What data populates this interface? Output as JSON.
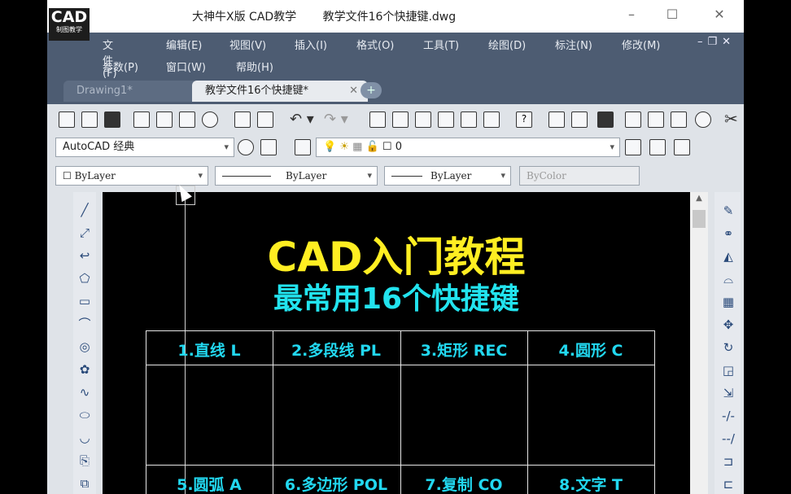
{
  "window": {
    "app_title": "大神牛X版 CAD教学",
    "file_title": "教学文件16个快捷键.dwg",
    "logo_big": "CAD",
    "logo_small": "制图教学"
  },
  "menu_row1": [
    "文件(F)",
    "编辑(E)",
    "视图(V)",
    "插入(I)",
    "格式(O)",
    "工具(T)",
    "绘图(D)",
    "标注(N)",
    "修改(M)"
  ],
  "menu_row2": [
    "参数(P)",
    "窗口(W)",
    "帮助(H)"
  ],
  "tabs": [
    {
      "label": "Drawing1*"
    },
    {
      "label": "教学文件16个快捷键*"
    }
  ],
  "workspace": {
    "value": "AutoCAD 经典"
  },
  "layer": {
    "value": "0"
  },
  "properties": {
    "color": "ByLayer",
    "linetype": "ByLayer",
    "lineweight": "ByLayer",
    "plotstyle": "ByColor"
  },
  "drawing": {
    "title": "CAD入门教程",
    "subtitle": "最常用16个快捷键",
    "row1": [
      "1.直线 L",
      "2.多段线 PL",
      "3.矩形 REC",
      "4.圆形 C"
    ],
    "row2": [
      "5.圆弧 A",
      "6.多边形 POL",
      "7.复制 CO",
      "8.文字 T"
    ]
  },
  "colors": {
    "title_yellow": "#ffee22",
    "cyan": "#22e3ee",
    "menubar": "#4d5c72"
  }
}
